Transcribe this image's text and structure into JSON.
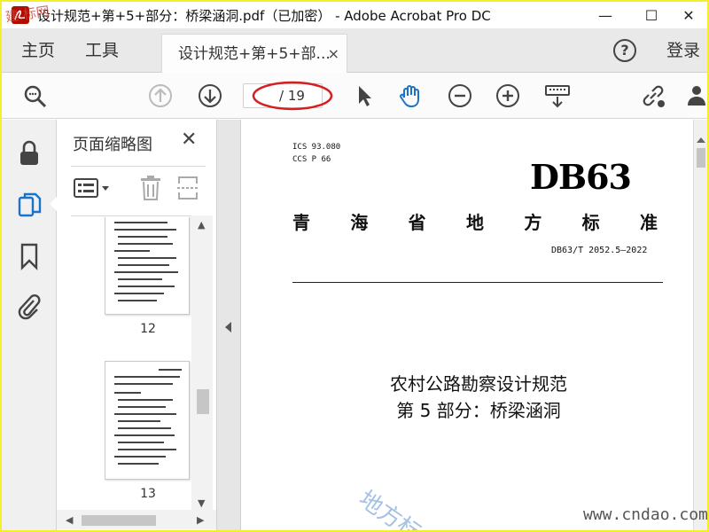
{
  "window": {
    "title": "设计规范+第+5+部分：桥梁涵洞.pdf（已加密） - Adobe Acrobat Pro DC",
    "minimize": "—",
    "maximize": "☐",
    "close": "✕"
  },
  "tabs": {
    "home": "主页",
    "tools": "工具",
    "document": "设计规范+第+5+部...",
    "document_close": "×",
    "help": "?",
    "login": "登录"
  },
  "toolbar": {
    "page_total": "/ 19",
    "icons": [
      "zoom-search-icon",
      "prev-page-icon",
      "next-page-icon",
      "select-arrow-icon",
      "hand-tool-icon",
      "zoom-out-icon",
      "zoom-in-icon",
      "keyboard-icon",
      "share-link-icon",
      "add-user-icon"
    ]
  },
  "left_rail": {
    "icons": [
      "lock-icon",
      "page-thumbnails-icon",
      "bookmark-icon",
      "attachment-icon"
    ]
  },
  "thumbnail_panel": {
    "title": "页面缩略图",
    "close": "✕",
    "pages": [
      {
        "number": "12"
      },
      {
        "number": "13"
      }
    ]
  },
  "document": {
    "ics": "ICS  93.080",
    "ccs": "CCS  P  66",
    "logo": "DB63",
    "std_title_chars": [
      "青",
      "海",
      "省",
      "地",
      "方",
      "标",
      "准"
    ],
    "std_number": "DB63/T 2052.5—2022",
    "title_line1": "农村公路勘察设计规范",
    "title_line2": "第 5 部分：桥梁涵洞"
  },
  "watermarks": {
    "corner": "建.标网",
    "diagonal": "地方标",
    "site": "www.cndao.com"
  },
  "colors": {
    "border_highlight": "#f3f02a",
    "annotation_red": "#d42020",
    "accent_blue": "#1a73c8"
  }
}
